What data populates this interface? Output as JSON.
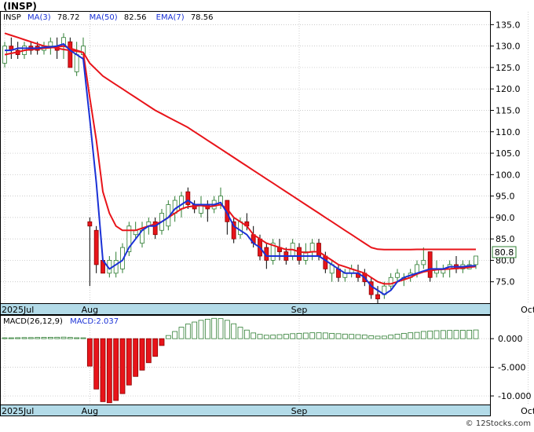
{
  "title": "(INSP)",
  "indicators": {
    "symbol": "INSP",
    "ma3_label": "MA(3)",
    "ma3_value": "78.72",
    "ma50_label": "MA(50)",
    "ma50_value": "82.56",
    "ema7_label": "EMA(7)",
    "ema7_value": "78.56"
  },
  "last_price_label": "80.8",
  "macd": {
    "params_label": "MACD(26,12,9)",
    "value_label": "MACD:2.037"
  },
  "watermark": "© 12Stocks.com",
  "colors": {
    "up": "#2e7d32",
    "down": "#e8141a",
    "ma3": "#1a31d6",
    "ma50": "#e8141a",
    "ema7": "#e8141a",
    "axis_band": "#b3dbe8",
    "macd_pos": "#2e7d32",
    "macd_neg": "#e8141a"
  },
  "chart_data": [
    {
      "type": "candlestick",
      "ylim": [
        70,
        138
      ],
      "price_ticks": [
        135,
        130,
        125,
        120,
        115,
        110,
        105,
        100,
        95,
        90,
        85,
        80,
        75
      ],
      "tick_labels": [
        "135.0",
        "130.0",
        "125.0",
        "120.0",
        "115.0",
        "110.0",
        "105.0",
        "100.0",
        "95.0",
        "90.0",
        "85.0",
        "80.0",
        "75.0"
      ],
      "month_labels": [
        {
          "label": "2025Jul",
          "index": 0
        },
        {
          "label": "Aug",
          "index": 13
        },
        {
          "label": "Sep",
          "index": 45
        },
        {
          "label": "Oct",
          "index": 80
        }
      ],
      "grid": true,
      "last_price": 80.8,
      "ohlc": [
        [
          126,
          131,
          125,
          130
        ],
        [
          130,
          132,
          127,
          129
        ],
        [
          129,
          131,
          127,
          128
        ],
        [
          128,
          131,
          127,
          130
        ],
        [
          130,
          131,
          128,
          129
        ],
        [
          130,
          131,
          128,
          129
        ],
        [
          129,
          131,
          128,
          130
        ],
        [
          130,
          132,
          128,
          131
        ],
        [
          130,
          132,
          127,
          129
        ],
        [
          130,
          133,
          127,
          132
        ],
        [
          131,
          132,
          126,
          125
        ],
        [
          124,
          131,
          123,
          128
        ],
        [
          128,
          132,
          127,
          130
        ],
        [
          89,
          90,
          74,
          88
        ],
        [
          87,
          88,
          77,
          79
        ],
        [
          80,
          81,
          77,
          77
        ],
        [
          77,
          81,
          76,
          80
        ],
        [
          77,
          82,
          76,
          80
        ],
        [
          78,
          84,
          77,
          83
        ],
        [
          82,
          89,
          81,
          88
        ],
        [
          86,
          89,
          85,
          87
        ],
        [
          84,
          89,
          83,
          87
        ],
        [
          88,
          90,
          86,
          89
        ],
        [
          89,
          90,
          85,
          86
        ],
        [
          87,
          92,
          86,
          91
        ],
        [
          88,
          94,
          87,
          93
        ],
        [
          91,
          95,
          89,
          94
        ],
        [
          92,
          96,
          90,
          95
        ],
        [
          96,
          97,
          92,
          93
        ],
        [
          93,
          94,
          91,
          92
        ],
        [
          91,
          95,
          90,
          93
        ],
        [
          93,
          94,
          89,
          92
        ],
        [
          92,
          95,
          91,
          94
        ],
        [
          93,
          97,
          92,
          95
        ],
        [
          94,
          94,
          86,
          89
        ],
        [
          89,
          90,
          84,
          85
        ],
        [
          86,
          90,
          85,
          89
        ],
        [
          89,
          91,
          87,
          88
        ],
        [
          86,
          88,
          83,
          84
        ],
        [
          85,
          86,
          80,
          81
        ],
        [
          83,
          84,
          78,
          80
        ],
        [
          80,
          85,
          79,
          84
        ],
        [
          83,
          85,
          80,
          82
        ],
        [
          82,
          83,
          79,
          80
        ],
        [
          81,
          85,
          80,
          84
        ],
        [
          83,
          84,
          79,
          80
        ],
        [
          80,
          84,
          79,
          82
        ],
        [
          82,
          85,
          80,
          84
        ],
        [
          84,
          85,
          80,
          81
        ],
        [
          81,
          82,
          77,
          78
        ],
        [
          77,
          80,
          75,
          79
        ],
        [
          78,
          79,
          75,
          76
        ],
        [
          76,
          78,
          75,
          77
        ],
        [
          77,
          79,
          76,
          78
        ],
        [
          77,
          79,
          75,
          76
        ],
        [
          77,
          78,
          74,
          75
        ],
        [
          75,
          76,
          71,
          72
        ],
        [
          72,
          74,
          70,
          71
        ],
        [
          72,
          75,
          71,
          74
        ],
        [
          74,
          77,
          73,
          76
        ],
        [
          76,
          78,
          75,
          77
        ],
        [
          76,
          77,
          74,
          76
        ],
        [
          76,
          78,
          75,
          77
        ],
        [
          77,
          80,
          76,
          79
        ],
        [
          79,
          83,
          78,
          80
        ],
        [
          82,
          82,
          75,
          76
        ],
        [
          77,
          80,
          76,
          78
        ],
        [
          77,
          79,
          76,
          78
        ],
        [
          78,
          80,
          76,
          79
        ],
        [
          79,
          81,
          77,
          78
        ],
        [
          78,
          80,
          77,
          79
        ],
        [
          78,
          80,
          78,
          79
        ],
        [
          79,
          81,
          78,
          81
        ]
      ],
      "ma3": [
        129,
        129,
        129.5,
        129.5,
        129.5,
        129.5,
        129.7,
        129.8,
        130,
        130.5,
        129,
        128,
        127,
        113,
        98,
        80,
        78,
        79,
        80,
        83,
        85,
        87,
        88,
        88,
        89,
        90,
        92,
        93,
        94,
        93,
        93,
        93,
        93,
        93.5,
        91,
        88,
        87,
        86,
        84,
        83,
        81,
        81,
        81,
        81,
        81,
        81,
        81,
        81,
        81,
        80,
        79,
        78,
        77,
        77,
        77,
        76,
        74,
        73,
        72,
        73,
        75,
        76,
        76.5,
        77,
        77.5,
        78,
        78,
        78,
        78.5,
        78.5,
        78.5,
        78.7,
        78.72
      ],
      "ma50": [
        133,
        132.5,
        132,
        131.5,
        131,
        130.5,
        130,
        129.8,
        129.5,
        129.2,
        129,
        128.8,
        128.5,
        126,
        124.5,
        123,
        122,
        121,
        120,
        119,
        118,
        117,
        116,
        115,
        114.2,
        113.4,
        112.6,
        111.8,
        111,
        110,
        109,
        108,
        107,
        106,
        105,
        104,
        103,
        102,
        101,
        100,
        99,
        98,
        97,
        96,
        95,
        94,
        93,
        92,
        91,
        90,
        89,
        88,
        87,
        86,
        85,
        84,
        83,
        82.6,
        82.5,
        82.5,
        82.5,
        82.5,
        82.5,
        82.55,
        82.56,
        82.56,
        82.56,
        82.56,
        82.56,
        82.56,
        82.56,
        82.56,
        82.56
      ],
      "ema7": [
        128,
        128.3,
        128.6,
        129,
        129.2,
        129.3,
        129.5,
        129.6,
        129.8,
        130,
        129.5,
        129,
        128.5,
        118,
        108,
        96,
        91,
        88,
        87,
        87,
        87,
        87.5,
        88,
        88.5,
        89,
        90,
        91,
        92,
        92.5,
        92.7,
        92.8,
        92.5,
        92.7,
        93,
        92,
        90,
        89,
        88,
        86,
        85,
        84,
        83.5,
        83,
        82.5,
        82.5,
        82,
        81.8,
        82,
        82,
        81,
        80,
        79,
        78.5,
        78,
        77.5,
        77,
        76,
        75,
        74.5,
        74.5,
        75,
        75.5,
        76,
        76.8,
        77.3,
        77.6,
        77.8,
        77.9,
        78,
        78.1,
        78.2,
        78.4,
        78.56
      ]
    },
    {
      "type": "bar",
      "name": "MACD",
      "ylim": [
        -11500,
        4000
      ],
      "ticks": [
        0,
        -5000,
        -10000
      ],
      "tick_labels": [
        "0.000",
        "-5.000",
        "-10.000"
      ],
      "values": [
        150,
        150,
        170,
        190,
        190,
        210,
        230,
        240,
        250,
        270,
        210,
        160,
        150,
        -4800,
        -8800,
        -11000,
        -11200,
        -10800,
        -9600,
        -8100,
        -6600,
        -5500,
        -4200,
        -3100,
        -1200,
        550,
        1250,
        2000,
        2550,
        2900,
        3200,
        3400,
        3550,
        3500,
        3200,
        2600,
        2000,
        1500,
        1000,
        750,
        600,
        620,
        700,
        780,
        870,
        930,
        980,
        1030,
        1030,
        1000,
        930,
        870,
        800,
        750,
        700,
        630,
        500,
        440,
        450,
        620,
        780,
        930,
        1030,
        1100,
        1260,
        1340,
        1390,
        1420,
        1440,
        1450,
        1470,
        1480,
        1520
      ]
    }
  ]
}
